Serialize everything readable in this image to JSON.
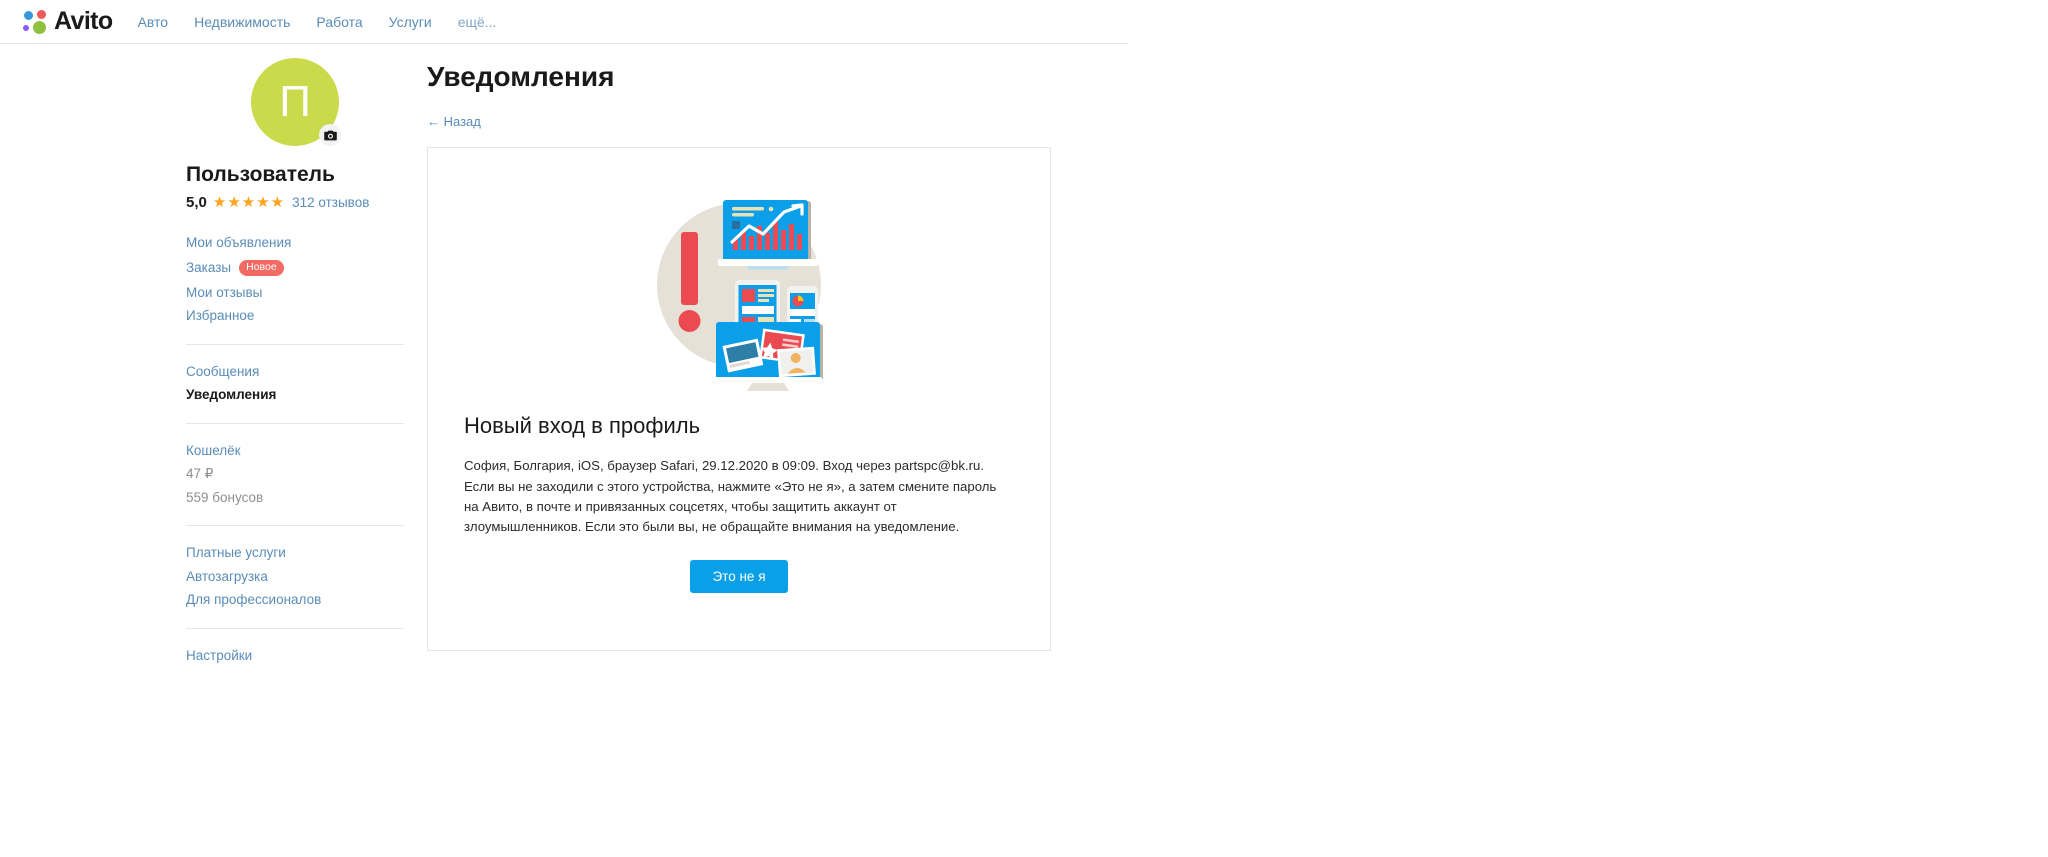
{
  "header": {
    "logo_text": "Avito",
    "logo_dots": [
      "#3498db",
      "#ec5b58",
      "#8b5cf6",
      "#8ec13f"
    ],
    "nav": [
      {
        "label": "Авто"
      },
      {
        "label": "Недвижимость"
      },
      {
        "label": "Работа"
      },
      {
        "label": "Услуги"
      },
      {
        "label": "ещё..."
      }
    ]
  },
  "sidebar": {
    "avatar": {
      "letter": "П",
      "color": "#cada4b",
      "camera_icon": "camera-icon"
    },
    "profile_name": "Пользователь",
    "rating": {
      "score": "5,0",
      "stars": 5,
      "star_color": "#ffa21e",
      "reviews_label": "312 отзывов"
    },
    "group1": [
      {
        "label": "Мои объявления",
        "badge": null
      },
      {
        "label": "Заказы",
        "badge": "Новое"
      },
      {
        "label": "Мои отзывы",
        "badge": null
      },
      {
        "label": "Избранное",
        "badge": null
      }
    ],
    "group2": [
      {
        "label": "Сообщения",
        "active": false
      },
      {
        "label": "Уведомления",
        "active": true
      }
    ],
    "group3": {
      "wallet_label": "Кошелёк",
      "balance": "47 ₽",
      "bonuses": "559 бонусов"
    },
    "group4": [
      {
        "label": "Платные услуги"
      },
      {
        "label": "Автозагрузка"
      },
      {
        "label": "Для профессионалов"
      }
    ],
    "group5": [
      {
        "label": "Настройки"
      }
    ]
  },
  "main": {
    "page_title": "Уведомления",
    "back_link": "← Назад",
    "notification": {
      "illustration_name": "devices-alert-illustration",
      "title": "Новый вход в профиль",
      "body": "София, Болгария, iOS, браузер Safari, 29.12.2020 в 09:09. Вход через partspc@bk.ru. Если вы не заходили с этого устройства, нажмите «Это не я», а затем смените пароль на Авито, в почте и привязанных соцсетях, чтобы защитить аккаунт от злоумышленников. Если это были вы, не обращайте внимания на уведомление.",
      "cta_label": "Это не я",
      "cta_color": "#0aa0e8"
    }
  }
}
